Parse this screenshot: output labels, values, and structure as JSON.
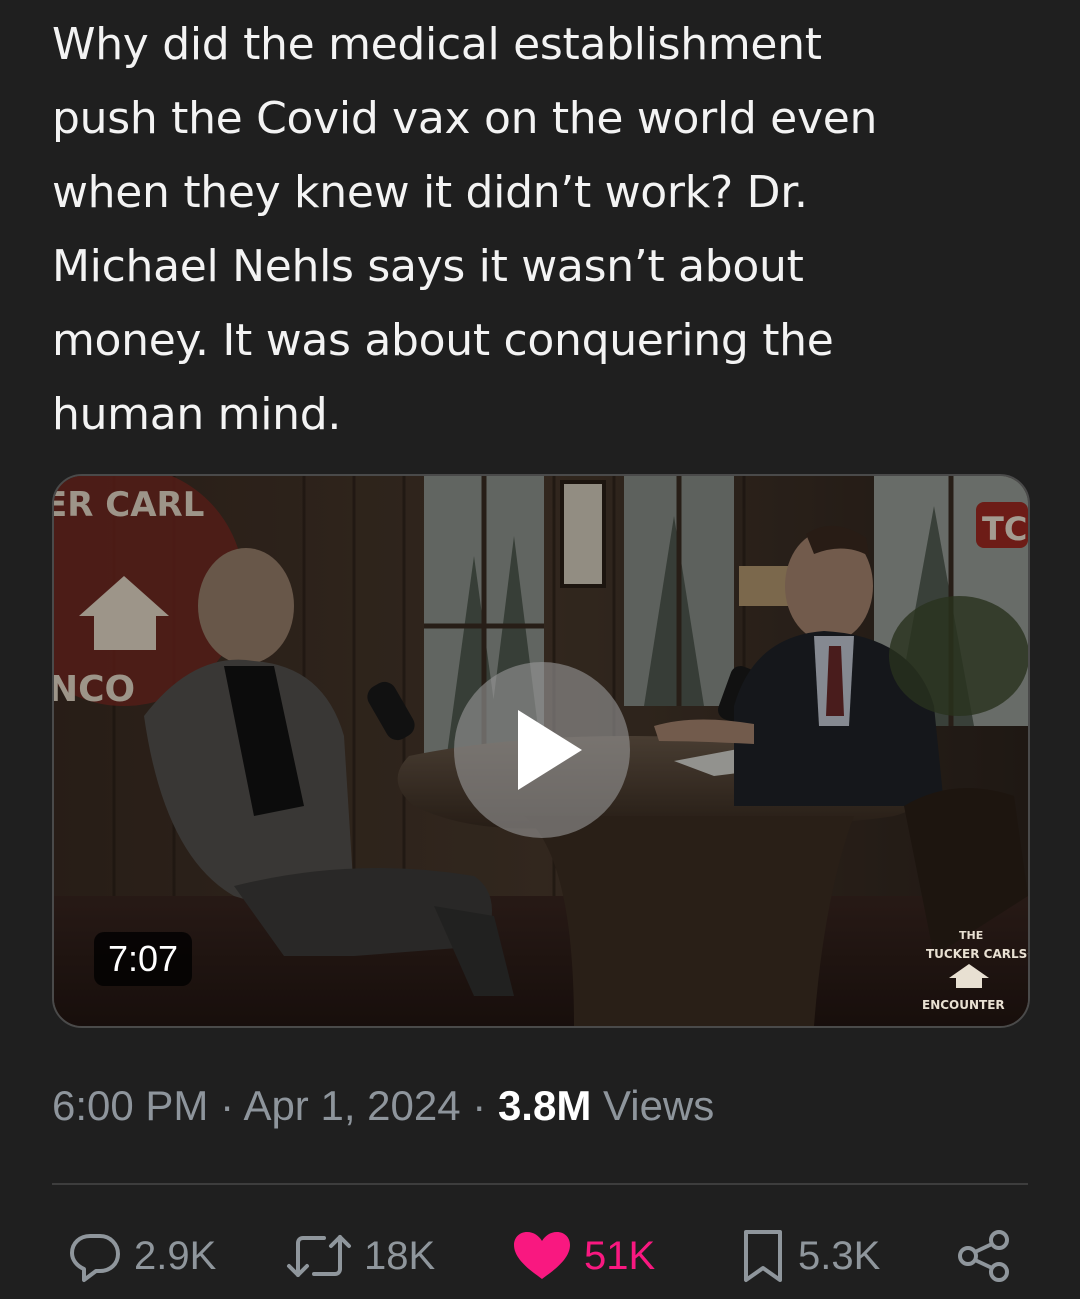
{
  "tweet": {
    "text": "Why did the medical establishment\npush the Covid vax on the world even\nwhen they knew it didn’t work? Dr.\nMichael Nehls says it wasn’t about\nmoney. It was about conquering the\nhuman mind."
  },
  "video": {
    "duration": "7:07",
    "overlay_text": {
      "sign_top": "ER CARL",
      "sign_bottom": "NCO",
      "sign_right": "TC",
      "watermark_the": "THE",
      "watermark_arc": "TUCKER CARLSON",
      "watermark_bottom": "ENCOUNTER"
    }
  },
  "meta": {
    "time": "6:00 PM",
    "separator": " · ",
    "date": "Apr 1, 2024",
    "views_count": "3.8M",
    "views_label": " Views"
  },
  "actions": {
    "replies": "2.9K",
    "reposts": "18K",
    "likes": "51K",
    "bookmarks": "5.3K"
  },
  "colors": {
    "background": "#1f1f1f",
    "text": "#f3f3f3",
    "muted": "#8e959c",
    "like": "#f91880",
    "divider": "#3d3d3d"
  },
  "icons": {
    "reply": "speech-bubble-icon",
    "repost": "repost-arrows-icon",
    "like": "heart-filled-icon",
    "bookmark": "bookmark-icon",
    "share": "share-nodes-icon",
    "play": "play-triangle-icon"
  }
}
